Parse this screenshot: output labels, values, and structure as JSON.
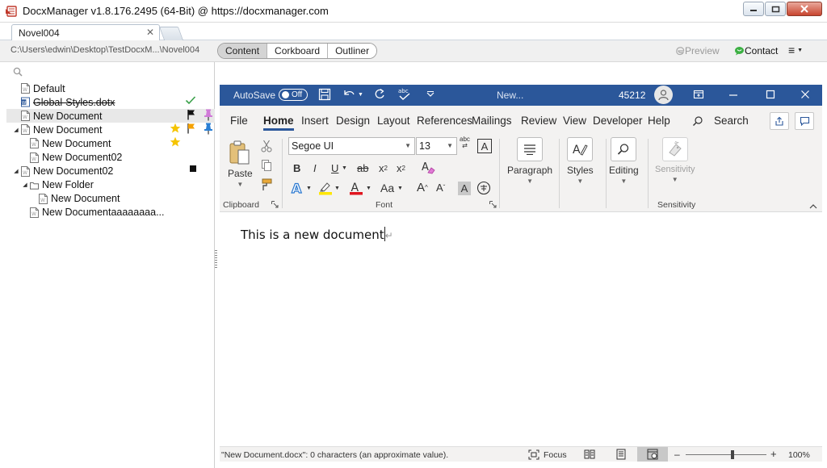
{
  "window": {
    "title": "DocxManager v1.8.176.2495 (64-Bit)  @  https://docxmanager.com"
  },
  "tabs": {
    "active_tab": "Novel004",
    "close_glyph": "✕"
  },
  "pathbar": {
    "path": "C:\\Users\\edwin\\Desktop\\TestDocxM...\\Novel004",
    "modes": [
      "Content",
      "Corkboard",
      "Outliner"
    ],
    "active_mode": "Content",
    "preview_label": "Preview",
    "contact_label": "Contact",
    "menu_glyph": "≡"
  },
  "tree": {
    "items": [
      {
        "label": "Default",
        "depth": 0,
        "expander": "",
        "icon": "doc",
        "strike": false,
        "selected": false,
        "marks": []
      },
      {
        "label": "Global-Styles.dotx",
        "depth": 0,
        "expander": "",
        "icon": "word",
        "strike": true,
        "selected": false,
        "marks": [
          "check"
        ]
      },
      {
        "label": "New Document",
        "depth": 0,
        "expander": "",
        "icon": "doc",
        "strike": false,
        "selected": true,
        "marks": [
          "flag-black",
          "pin-pink"
        ]
      },
      {
        "label": "New Document",
        "depth": 0,
        "expander": "◢",
        "icon": "doc",
        "strike": false,
        "selected": false,
        "marks": [
          "star",
          "flag-orange",
          "pin-blue"
        ]
      },
      {
        "label": "New Document",
        "depth": 1,
        "expander": "",
        "icon": "doc",
        "strike": false,
        "selected": false,
        "marks": [
          "star"
        ]
      },
      {
        "label": "New Document02",
        "depth": 1,
        "expander": "",
        "icon": "doc",
        "strike": false,
        "selected": false,
        "marks": []
      },
      {
        "label": "New Document02",
        "depth": 0,
        "expander": "◢",
        "icon": "doc",
        "strike": false,
        "selected": false,
        "marks": [
          "square"
        ]
      },
      {
        "label": "New Folder",
        "depth": 1,
        "expander": "◢",
        "icon": "folder",
        "strike": false,
        "selected": false,
        "marks": []
      },
      {
        "label": "New Document",
        "depth": 2,
        "expander": "",
        "icon": "doc",
        "strike": false,
        "selected": false,
        "marks": []
      },
      {
        "label": "New Documentaaaaaaaa...",
        "depth": 1,
        "expander": "",
        "icon": "doc",
        "strike": false,
        "selected": false,
        "marks": []
      }
    ]
  },
  "word": {
    "autosave_label": "AutoSave",
    "autosave_state": "Off",
    "doc_title": "New...",
    "counter": "45212",
    "tabs": [
      "File",
      "Home",
      "Insert",
      "Design",
      "Layout",
      "References",
      "Mailings",
      "Review",
      "View",
      "Developer",
      "Help"
    ],
    "active_tab": "Home",
    "search_label": "Search",
    "ribbon": {
      "paste_label": "Paste",
      "clipboard_label": "Clipboard",
      "font_name": "Segoe UI",
      "font_size": "13",
      "font_label": "Font",
      "paragraph_label": "Paragraph",
      "styles_label": "Styles",
      "editing_label": "Editing",
      "sensitivity_button_label": "Sensitivity",
      "sensitivity_group_label": "Sensitivity",
      "bold": "B",
      "italic": "I",
      "underline": "U",
      "strikethrough": "ab",
      "subscript": "x",
      "superscript": "x",
      "change_case": "Aa",
      "grow_font": "A",
      "shrink_font": "A",
      "font_color": "A",
      "text_effects": "A",
      "clear_format": "A",
      "abc_label": "abc"
    },
    "document_text": "This is a new document",
    "status_text": "\"New Document.docx\": 0 characters (an approximate value).",
    "focus_label": "Focus",
    "zoom_minus": "–",
    "zoom_plus": "+",
    "zoom": "100%",
    "zoom_level": 0.58
  },
  "colors": {
    "word_blue": "#2b579a",
    "star": "#f5c400",
    "check": "#3aa14a",
    "flag_orange": "#f5a100",
    "pin_blue": "#2a7fd4",
    "pin_pink": "#d07ad8"
  }
}
